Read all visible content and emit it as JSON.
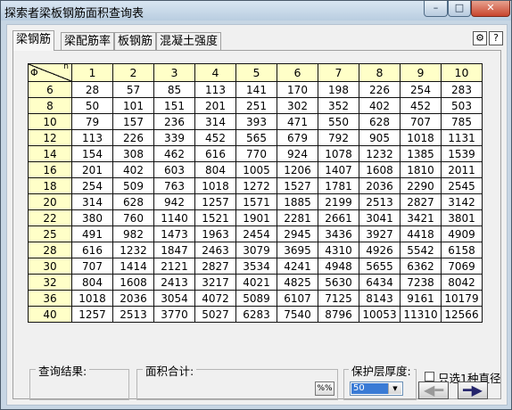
{
  "window": {
    "title": "探索者梁板钢筋面积查询表",
    "min_glyph": "–",
    "max_glyph": "□",
    "close_glyph": "✕"
  },
  "tabs": [
    {
      "label": "梁钢筋",
      "active": true
    },
    {
      "label": "梁配筋率",
      "active": false
    },
    {
      "label": "板钢筋",
      "active": false
    },
    {
      "label": "混凝土强度",
      "active": false
    }
  ],
  "toolbar_icons": [
    {
      "name": "settings-icon",
      "glyph": "⚙"
    },
    {
      "name": "help-icon",
      "glyph": "?"
    }
  ],
  "table": {
    "corner": {
      "row_symbol": "Φ",
      "col_symbol": "n"
    },
    "columns": [
      "1",
      "2",
      "3",
      "4",
      "5",
      "6",
      "7",
      "8",
      "9",
      "10"
    ],
    "rows": [
      {
        "d": "6",
        "cells": [
          "28",
          "57",
          "85",
          "113",
          "141",
          "170",
          "198",
          "226",
          "254",
          "283"
        ]
      },
      {
        "d": "8",
        "cells": [
          "50",
          "101",
          "151",
          "201",
          "251",
          "302",
          "352",
          "402",
          "452",
          "503"
        ]
      },
      {
        "d": "10",
        "cells": [
          "79",
          "157",
          "236",
          "314",
          "393",
          "471",
          "550",
          "628",
          "707",
          "785"
        ]
      },
      {
        "d": "12",
        "cells": [
          "113",
          "226",
          "339",
          "452",
          "565",
          "679",
          "792",
          "905",
          "1018",
          "1131"
        ]
      },
      {
        "d": "14",
        "cells": [
          "154",
          "308",
          "462",
          "616",
          "770",
          "924",
          "1078",
          "1232",
          "1385",
          "1539"
        ]
      },
      {
        "d": "16",
        "cells": [
          "201",
          "402",
          "603",
          "804",
          "1005",
          "1206",
          "1407",
          "1608",
          "1810",
          "2011"
        ]
      },
      {
        "d": "18",
        "cells": [
          "254",
          "509",
          "763",
          "1018",
          "1272",
          "1527",
          "1781",
          "2036",
          "2290",
          "2545"
        ]
      },
      {
        "d": "20",
        "cells": [
          "314",
          "628",
          "942",
          "1257",
          "1571",
          "1885",
          "2199",
          "2513",
          "2827",
          "3142"
        ]
      },
      {
        "d": "22",
        "cells": [
          "380",
          "760",
          "1140",
          "1521",
          "1901",
          "2281",
          "2661",
          "3041",
          "3421",
          "3801"
        ]
      },
      {
        "d": "25",
        "cells": [
          "491",
          "982",
          "1473",
          "1963",
          "2454",
          "2945",
          "3436",
          "3927",
          "4418",
          "4909"
        ]
      },
      {
        "d": "28",
        "cells": [
          "616",
          "1232",
          "1847",
          "2463",
          "3079",
          "3695",
          "4310",
          "4926",
          "5542",
          "6158"
        ]
      },
      {
        "d": "30",
        "cells": [
          "707",
          "1414",
          "2121",
          "2827",
          "3534",
          "4241",
          "4948",
          "5655",
          "6362",
          "7069"
        ]
      },
      {
        "d": "32",
        "cells": [
          "804",
          "1608",
          "2413",
          "3217",
          "4021",
          "4825",
          "5630",
          "6434",
          "7238",
          "8042"
        ]
      },
      {
        "d": "36",
        "cells": [
          "1018",
          "2036",
          "3054",
          "4072",
          "5089",
          "6107",
          "7125",
          "8143",
          "9161",
          "10179"
        ]
      },
      {
        "d": "40",
        "cells": [
          "1257",
          "2513",
          "3770",
          "5027",
          "6283",
          "7540",
          "8796",
          "10053",
          "11310",
          "12566"
        ]
      }
    ]
  },
  "bottom": {
    "query_result_label": "查询结果:",
    "area_total_label": "面积合计:",
    "percent_button": "%%",
    "cover_label": "保护层厚度:",
    "cover_value": "50",
    "only_one_diameter_label": "只选1种直径",
    "only_one_diameter_checked": false,
    "prev_glyph": "◀━",
    "next_glyph": "━▶"
  }
}
